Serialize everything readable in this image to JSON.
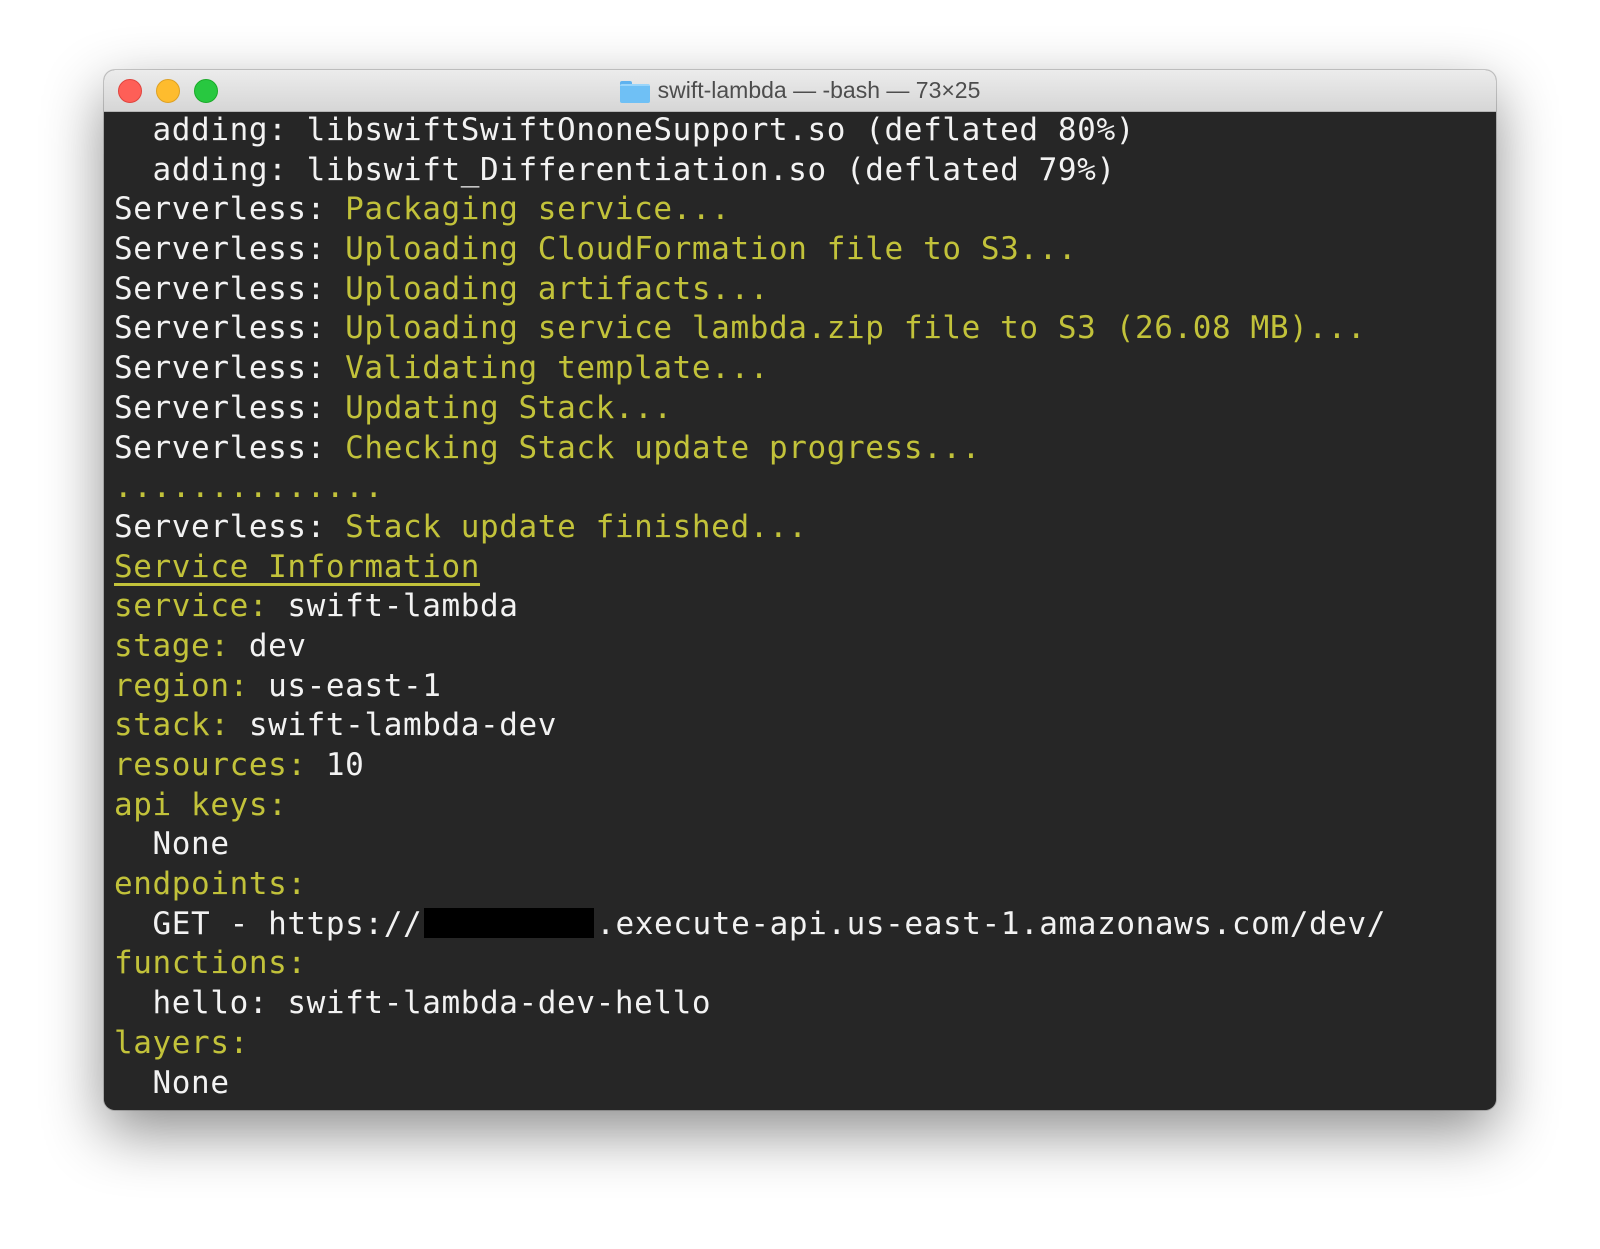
{
  "window": {
    "title": "swift-lambda — -bash — 73×25",
    "colors": {
      "close": "#fe5f57",
      "minimize": "#febc2e",
      "zoom": "#28c840",
      "accent_yellow": "#c2c23a",
      "terminal_bg": "#262626"
    }
  },
  "terminal": {
    "adding_1": "  adding: libswiftSwiftOnoneSupport.so (deflated 80%)",
    "adding_2": "  adding: libswift_Differentiation.so (deflated 79%)",
    "serverless_prefix": "Serverless: ",
    "messages": [
      "Packaging service...",
      "Uploading CloudFormation file to S3...",
      "Uploading artifacts...",
      "Uploading service lambda.zip file to S3 (26.08 MB)...",
      "Validating template...",
      "Updating Stack...",
      "Checking Stack update progress..."
    ],
    "progress_dots": "..............",
    "finished": "Stack update finished...",
    "service_info_heading": "Service Information",
    "service_key": "service:",
    "service_value": " swift-lambda",
    "stage_key": "stage:",
    "stage_value": " dev",
    "region_key": "region:",
    "region_value": " us-east-1",
    "stack_key": "stack:",
    "stack_value": " swift-lambda-dev",
    "resources_key": "resources:",
    "resources_value": " 10",
    "api_keys_key": "api keys:",
    "api_keys_value": "  None",
    "endpoints_key": "endpoints:",
    "endpoint_prefix": "  GET - https://",
    "endpoint_suffix": ".execute-api.us-east-1.amazonaws.com/dev/",
    "functions_key": "functions:",
    "function_entry": "  hello: swift-lambda-dev-hello",
    "layers_key": "layers:",
    "layers_value": "  None"
  }
}
